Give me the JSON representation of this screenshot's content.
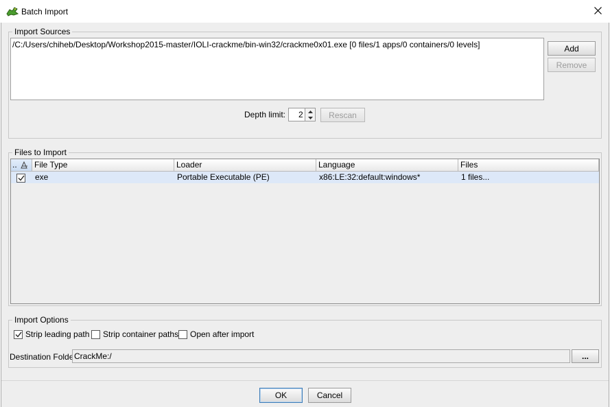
{
  "window": {
    "title": "Batch Import",
    "close_icon": "close-icon"
  },
  "import_sources": {
    "legend": "Import Sources",
    "items": [
      "/C:/Users/chiheb/Desktop/Workshop2015-master/IOLI-crackme/bin-win32/crackme0x01.exe [0 files/1 apps/0 containers/0 levels]"
    ],
    "add_label": "Add",
    "remove_label": "Remove",
    "depth_label": "Depth limit:",
    "depth_value": "2",
    "rescan_label": "Rescan"
  },
  "files_to_import": {
    "legend": "Files to Import",
    "select_all_header": "..",
    "columns": [
      "File Type",
      "Loader",
      "Language",
      "Files"
    ],
    "rows": [
      {
        "checked": true,
        "file_type": "exe",
        "loader": "Portable Executable (PE)",
        "language": "x86:LE:32:default:windows*",
        "files": "1 files..."
      }
    ]
  },
  "import_options": {
    "legend": "Import Options",
    "strip_leading_path": {
      "label": "Strip leading path",
      "checked": true
    },
    "strip_container_paths": {
      "label": "Strip container paths",
      "checked": false
    },
    "open_after_import": {
      "label": "Open after import",
      "checked": false
    },
    "destination_label": "Destination Folder",
    "destination_value": "CrackMe:/",
    "browse_label": "..."
  },
  "footer": {
    "ok_label": "OK",
    "cancel_label": "Cancel"
  },
  "colors": {
    "selection": "#dde8f8",
    "default_button_border": "#3d7bb6",
    "client_bg": "#eeeeee"
  }
}
